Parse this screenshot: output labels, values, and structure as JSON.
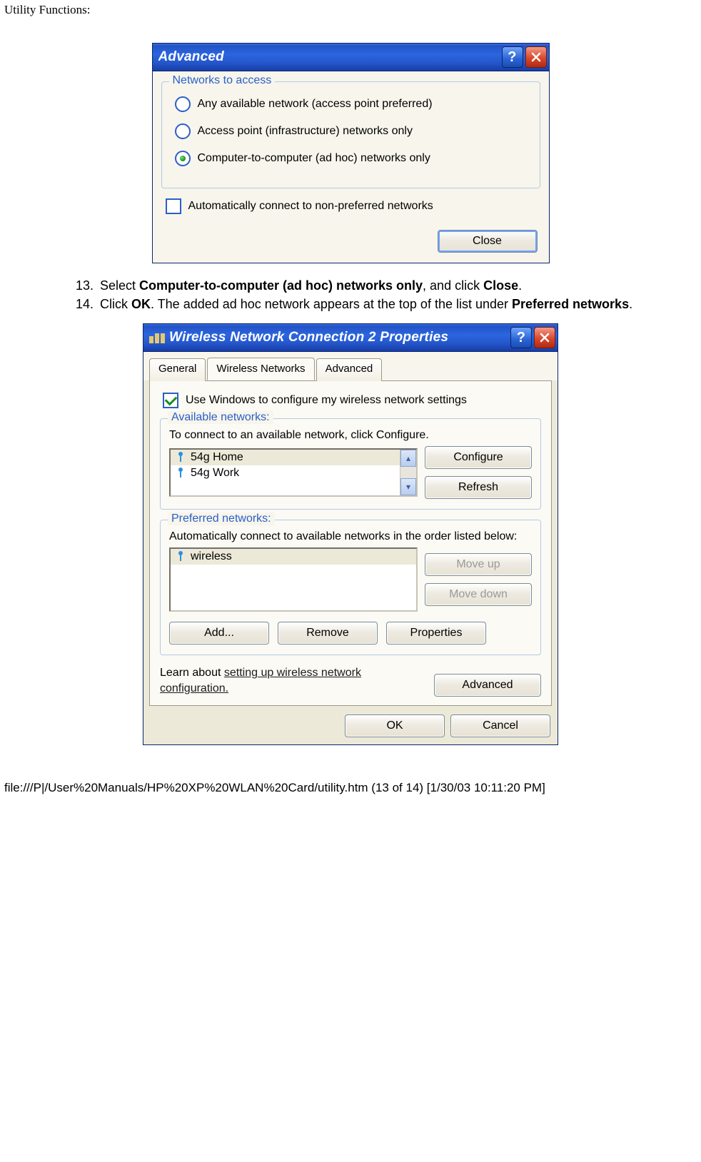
{
  "page": {
    "header": "Utility Functions:",
    "footer": "file:///P|/User%20Manuals/HP%20XP%20WLAN%20Card/utility.htm (13 of 14) [1/30/03 10:11:20 PM]"
  },
  "instructions": {
    "n13": "13.",
    "t13_a": "Select ",
    "t13_b": "Computer-to-computer (ad hoc) networks only",
    "t13_c": ", and click ",
    "t13_d": "Close",
    "t13_e": ".",
    "n14": "14.",
    "t14_a": "Click ",
    "t14_b": "OK",
    "t14_c": ". The added ad hoc network appears at the top of the list under ",
    "t14_d": "Preferred networks",
    "t14_e": "."
  },
  "advanced_dialog": {
    "title": "Advanced",
    "group_legend": "Networks to access",
    "radio1": "Any available network (access point preferred)",
    "radio2": "Access point (infrastructure) networks only",
    "radio3": "Computer-to-computer (ad hoc) networks only",
    "selected_radio": 3,
    "auto_connect_label": "Automatically connect to non-preferred networks",
    "auto_connect_checked": false,
    "close_button": "Close"
  },
  "properties_dialog": {
    "title": "Wireless Network Connection 2 Properties",
    "tabs": {
      "general": "General",
      "wireless": "Wireless Networks",
      "advanced": "Advanced"
    },
    "active_tab": "wireless",
    "use_windows_label": "Use Windows to configure my wireless network settings",
    "use_windows_checked": true,
    "available": {
      "legend": "Available networks:",
      "hint": "To connect to an available network, click Configure.",
      "items": [
        "54g Home",
        "54g Work"
      ],
      "configure": "Configure",
      "refresh": "Refresh"
    },
    "preferred": {
      "legend": "Preferred networks:",
      "hint": "Automatically connect to available networks in the order listed below:",
      "items": [
        "wireless"
      ],
      "move_up": "Move up",
      "move_down": "Move down",
      "add": "Add...",
      "remove": "Remove",
      "properties": "Properties"
    },
    "learn_a": "Learn about ",
    "learn_link": "setting up wireless network configuration.",
    "advanced_button": "Advanced",
    "ok": "OK",
    "cancel": "Cancel"
  }
}
